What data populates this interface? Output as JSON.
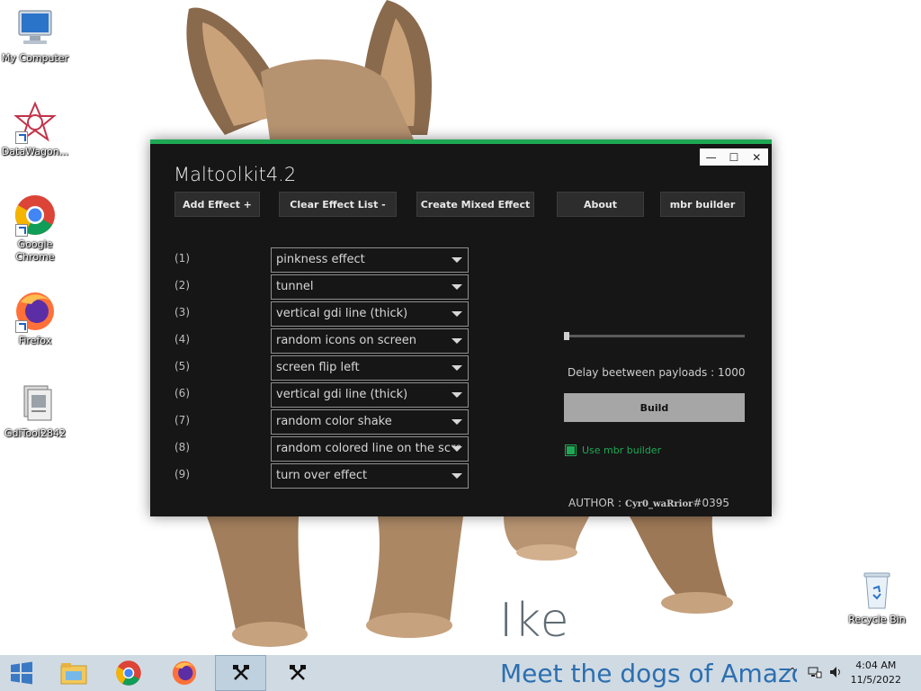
{
  "desktop": {
    "wallpaper": {
      "name": "Ike",
      "tagline": "Meet the dogs of Amazon"
    },
    "icons": [
      {
        "label": "My Computer",
        "icon": "computer-icon"
      },
      {
        "label": "DataWagon...",
        "icon": "datawagon-icon",
        "shortcut": true
      },
      {
        "label": "Google Chrome",
        "icon": "chrome-icon",
        "shortcut": true
      },
      {
        "label": "Firefox",
        "icon": "firefox-icon",
        "shortcut": true
      },
      {
        "label": "GdiTool2842",
        "icon": "gditool-icon"
      },
      {
        "label": "Recycle Bin",
        "icon": "recycle-bin-icon"
      }
    ]
  },
  "app": {
    "title": "Maltoolkit4.2",
    "accent_color": "#1fa854",
    "window_controls": {
      "minimize": "—",
      "maximize": "☐",
      "close": "✕"
    },
    "buttons": {
      "add_effect": "Add Effect +",
      "clear_effect_list": "Clear Effect List -",
      "create_mixed_effect": "Create Mixed Effect",
      "about": "About",
      "mbr_builder": "mbr builder"
    },
    "effects": [
      {
        "num": "(1)",
        "value": "pinkness effect"
      },
      {
        "num": "(2)",
        "value": "tunnel"
      },
      {
        "num": "(3)",
        "value": "vertical gdi line (thick)"
      },
      {
        "num": "(4)",
        "value": "random icons on screen"
      },
      {
        "num": "(5)",
        "value": "screen flip left"
      },
      {
        "num": "(6)",
        "value": "vertical gdi line (thick)"
      },
      {
        "num": "(7)",
        "value": "random color shake"
      },
      {
        "num": "(8)",
        "value": "random colored line on the scree"
      },
      {
        "num": "(9)",
        "value": "turn over effect"
      }
    ],
    "delay_slider_level": 0,
    "delay_label": "Delay beetween payloads : 1000",
    "build_label": "Build",
    "use_mbr_builder": {
      "label": "Use mbr builder",
      "checked": true
    },
    "author": {
      "prefix": "AUTHOR :",
      "name": "Cyr0_waRrior",
      "suffix": "#0395"
    }
  },
  "taskbar": {
    "start_icon": "windows-start-icon",
    "apps": [
      "file-explorer-icon",
      "chrome-icon",
      "firefox-icon",
      "maltoolkit-icon",
      "maltoolkit-icon"
    ],
    "tray": {
      "chevron": "^"
    },
    "clock": {
      "time": "4:04 AM",
      "date": "11/5/2022"
    }
  }
}
